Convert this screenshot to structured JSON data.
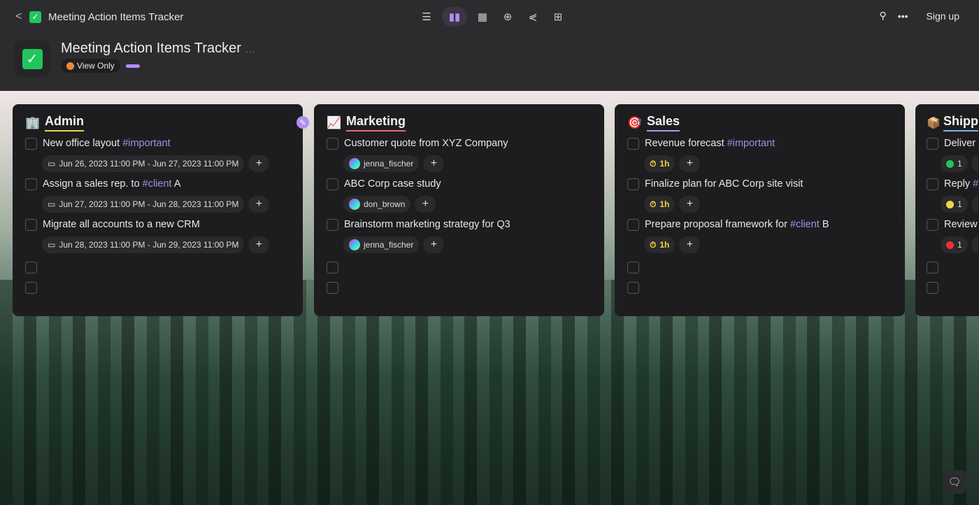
{
  "app": {
    "title": "Meeting Action Items Tracker",
    "view_only": "View Only",
    "more": "...",
    "sign_up": "Sign up"
  },
  "views": [
    {
      "icon": "list-view-icon"
    },
    {
      "icon": "board-view-icon",
      "active": true
    },
    {
      "icon": "calendar-view-icon"
    },
    {
      "icon": "table-view-icon"
    },
    {
      "icon": "share-graph-icon"
    },
    {
      "icon": "hierarchy-view-icon"
    }
  ],
  "colors": {
    "accent": "#b38cf5",
    "check": "#22c55e",
    "tag": "#a88ce8"
  },
  "columns": [
    {
      "title": "Admin",
      "icon": "🏢",
      "underline": "#e8d64a",
      "tasks": [
        {
          "text": "New office layout ",
          "tag": "#important",
          "suffix": "",
          "chip": {
            "type": "date",
            "label": "Jun 26, 2023 11:00 PM - Jun 27, 2023 11:00 PM"
          }
        },
        {
          "text": "Assign a sales rep. to ",
          "tag": "#client",
          "suffix": " A",
          "chip": {
            "type": "date",
            "label": "Jun 27, 2023 11:00 PM - Jun 28, 2023 11:00 PM"
          }
        },
        {
          "text": "Migrate all accounts to a new CRM",
          "tag": "",
          "suffix": "",
          "chip": {
            "type": "date",
            "label": "Jun 28, 2023 11:00 PM - Jun 29, 2023 11:00 PM"
          }
        }
      ]
    },
    {
      "title": "Marketing",
      "icon": "📈",
      "underline": "#e86a7a",
      "tasks": [
        {
          "text": "Customer quote from XYZ Company",
          "tag": "",
          "suffix": "",
          "chip": {
            "type": "user",
            "label": "jenna_fischer"
          }
        },
        {
          "text": "ABC Corp case study",
          "tag": "",
          "suffix": "",
          "chip": {
            "type": "user",
            "label": "don_brown"
          }
        },
        {
          "text": "Brainstorm marketing strategy for Q3",
          "tag": "",
          "suffix": "",
          "chip": {
            "type": "user",
            "label": "jenna_fischer"
          }
        }
      ]
    },
    {
      "title": "Sales",
      "icon": "🎯",
      "underline": "#a89ce8",
      "tasks": [
        {
          "text": "Revenue forecast ",
          "tag": "#important",
          "suffix": "",
          "chip": {
            "type": "timer",
            "label": "1h"
          }
        },
        {
          "text": "Finalize plan for ABC Corp site visit",
          "tag": "",
          "suffix": "",
          "chip": {
            "type": "timer",
            "label": "1h"
          }
        },
        {
          "text": "Prepare proposal framework for ",
          "tag": "#client",
          "suffix": " B",
          "chip": {
            "type": "timer",
            "label": "1h"
          }
        }
      ]
    },
    {
      "title": "Shipp",
      "icon": "📦",
      "underline": "#7ab8e8",
      "tasks": [
        {
          "text": "Deliver",
          "tag": "",
          "suffix": "",
          "chip": {
            "type": "priority",
            "label": "1",
            "color": "#22c55e"
          }
        },
        {
          "text": "Reply ",
          "tag": "#",
          "suffix": "",
          "chip": {
            "type": "priority",
            "label": "1",
            "color": "#f2d640"
          }
        },
        {
          "text": "Review",
          "tag": "",
          "suffix": "",
          "chip": {
            "type": "priority",
            "label": "1",
            "color": "#ef3030"
          }
        }
      ]
    }
  ]
}
